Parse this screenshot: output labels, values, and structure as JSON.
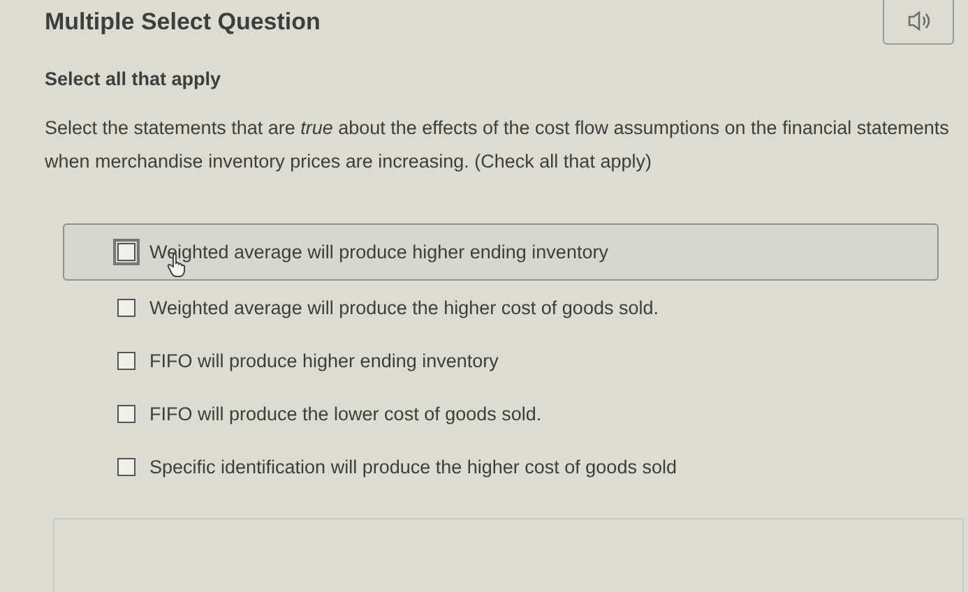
{
  "header": {
    "title": "Multiple Select Question"
  },
  "instruction": "Select all that apply",
  "question": "Select the statements that are *true* about the effects of the cost flow assumptions on the financial statements when merchandise inventory prices are increasing. (Check all that apply)",
  "options": [
    {
      "label": "Weighted average will produce higher ending inventory",
      "checked": false,
      "hovered": true
    },
    {
      "label": "Weighted average will produce the higher cost of goods sold.",
      "checked": false,
      "hovered": false
    },
    {
      "label": "FIFO will produce higher ending inventory",
      "checked": false,
      "hovered": false
    },
    {
      "label": "FIFO will produce the lower cost of goods sold.",
      "checked": false,
      "hovered": false
    },
    {
      "label": "Specific identification will produce the higher cost of goods sold",
      "checked": false,
      "hovered": false
    }
  ]
}
